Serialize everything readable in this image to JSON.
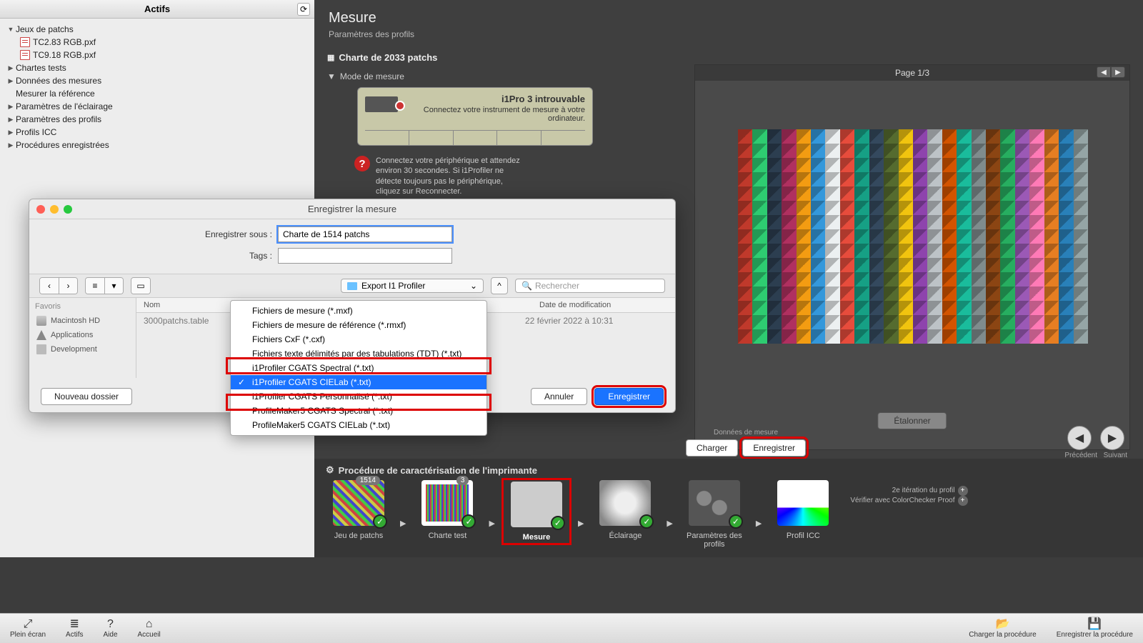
{
  "left": {
    "title": "Actifs",
    "tree": {
      "patchsets": "Jeux de patchs",
      "file1": "TC2.83 RGB.pxf",
      "file2": "TC9.18 RGB.pxf",
      "testcharts": "Chartes tests",
      "measuredata": "Données des mesures",
      "measureref": "Mesurer la référence",
      "lighting": "Paramètres de l'éclairage",
      "profiles": "Paramètres des profils",
      "icc": "Profils ICC",
      "saved": "Procédures enregistrées"
    }
  },
  "main": {
    "title": "Mesure",
    "subtitle": "Paramètres des profils",
    "chart_header": "Charte de 2033 patchs",
    "mode_header": "Mode de mesure",
    "device_title": "i1Pro 3 introuvable",
    "device_msg": "Connectez votre instrument de mesure à votre ordinateur.",
    "warn_msg": "Connectez votre périphérique et attendez environ 30 secondes. Si i1Profiler ne détecte toujours pas le périphérique, cliquez sur Reconnecter.",
    "reconnect": "Reconnecter",
    "page_label": "Page 1/3",
    "calibrate": "Étalonner",
    "data_label": "Données de mesure",
    "load": "Charger",
    "save": "Enregistrer",
    "prev": "Précédent",
    "next": "Suivant"
  },
  "workflow": {
    "header": "Procédure de caractérisation de l'imprimante",
    "steps": {
      "patchset": "Jeu de patchs",
      "testchart": "Charte test",
      "measure": "Mesure",
      "lighting": "Éclairage",
      "profparams": "Paramètres des profils",
      "icc": "Profil ICC"
    },
    "badge1": "1514",
    "badge2": "3",
    "extra1": "2e itération du profil",
    "extra2": "Vérifier avec ColorChecker Proof"
  },
  "bottom": {
    "fullscreen": "Plein écran",
    "assets": "Actifs",
    "help": "Aide",
    "home": "Accueil",
    "loadproc": "Charger la procédure",
    "saveproc": "Enregistrer la procédure"
  },
  "dialog": {
    "title": "Enregistrer la mesure",
    "saveas_label": "Enregistrer sous :",
    "saveas_value": "Charte de 1514 patchs",
    "tags_label": "Tags :",
    "folder": "Export I1 Profiler",
    "search_placeholder": "Rechercher",
    "favorites": "Favoris",
    "hd": "Macintosh HD",
    "apps": "Applications",
    "dev": "Development",
    "col_name": "Nom",
    "col_date": "Date de modification",
    "file": "3000patchs.table",
    "file_date": "22 février 2022 à 10:31",
    "new_folder": "Nouveau dossier",
    "cancel": "Annuler",
    "save": "Enregistrer"
  },
  "dropdown": {
    "mxf": "Fichiers de mesure (*.mxf)",
    "rmxf": "Fichiers de mesure de référence (*.rmxf)",
    "cxf": "Fichiers CxF (*.cxf)",
    "tdt": "Fichiers texte délimités par des tabulations (TDT) (*.txt)",
    "spectral": "i1Profiler CGATS Spectral (*.txt)",
    "cielab": "i1Profiler CGATS CIELab (*.txt)",
    "custom": "i1Profiler CGATS Personnalisé (*.txt)",
    "pm5spec": "ProfileMaker5 CGATS Spectral (*.txt)",
    "pm5lab": "ProfileMaker5 CGATS CIELab (*.txt)"
  }
}
